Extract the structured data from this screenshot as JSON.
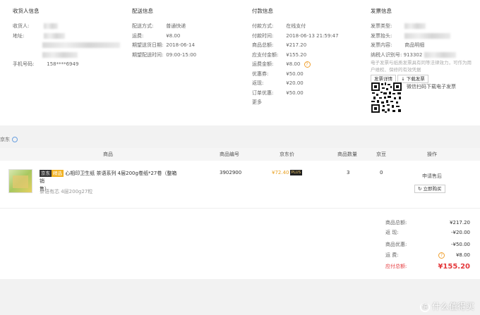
{
  "receiver": {
    "title": "收货人信息",
    "name_label": "收货人:",
    "address_label": "地址:",
    "phone_label": "手机号码:",
    "phone_value": "158****6949"
  },
  "delivery": {
    "title": "配送信息",
    "method_label": "配送方式:",
    "method_value": "普通快递",
    "fee_label": "运费:",
    "fee_value": "¥8.00",
    "date_label": "期望送货日期:",
    "date_value": "2018-06-14",
    "time_label": "期望配送时间:",
    "time_value": "09:00-15:00"
  },
  "payment": {
    "title": "付款信息",
    "method_label": "付款方式:",
    "method_value": "在线支付",
    "time_label": "付款时间:",
    "time_value": "2018-06-13 21:59:47",
    "goods_total_label": "商品总额:",
    "goods_total_value": "¥217.20",
    "payable_label": "应支付金额:",
    "payable_value": "¥155.20",
    "freight_label": "运费金额:",
    "freight_value": "¥8.00",
    "coupon_label": "优惠券:",
    "coupon_value": "¥50.00",
    "cashback_label": "返现:",
    "cashback_value": "¥20.00",
    "order_discount_label": "订单优惠:",
    "order_discount_value": "¥50.00",
    "more_label": "更多",
    "help_icon": "?"
  },
  "invoice": {
    "title": "发票信息",
    "type_label": "发票类型:",
    "header_label": "发票抬头:",
    "content_label": "发票内容:",
    "content_value": "商品明细",
    "taxid_label": "纳税人识别号:",
    "taxid_value": "913302",
    "note": "电子发票与纸质发票具有同等法律效力，可作为用户维权、保修的有效凭据",
    "detail_button": "发票详情",
    "download_button": "↓ 下载发票",
    "qr_text": "微信扫码下载电子发票"
  },
  "store": {
    "name": "京东"
  },
  "table": {
    "headers": {
      "product": "商品",
      "code": "商品编号",
      "price": "京东价",
      "qty": "商品数量",
      "beans": "京豆",
      "action": "操作"
    }
  },
  "item": {
    "tag_jd": "京东",
    "tag_pick": "精选",
    "title_line1": "心相印卫生纸 茶语系列 4层200g卷纸*27卷（整箱销",
    "title_line2": "售）",
    "spec": "茶语有芯 4层200g27粒",
    "code": "3902900",
    "price": "¥72.40",
    "plus": "PLUS",
    "qty": "3",
    "beans": "0",
    "after_sale": "申请售后",
    "buy_again": "立即购买"
  },
  "summary": {
    "goods_total_label": "商品总额:",
    "goods_total_value": "¥217.20",
    "cashback_label": "返      现:",
    "cashback_value": "-¥20.00",
    "discount_label": "商品优惠:",
    "discount_value": "-¥50.00",
    "freight_label": "运      费:",
    "freight_value": "¥8.00",
    "total_label": "应付总额:",
    "total_value": "¥155.20",
    "help_icon": "?"
  },
  "watermark": {
    "text": "什么值得买",
    "icon": "值"
  }
}
